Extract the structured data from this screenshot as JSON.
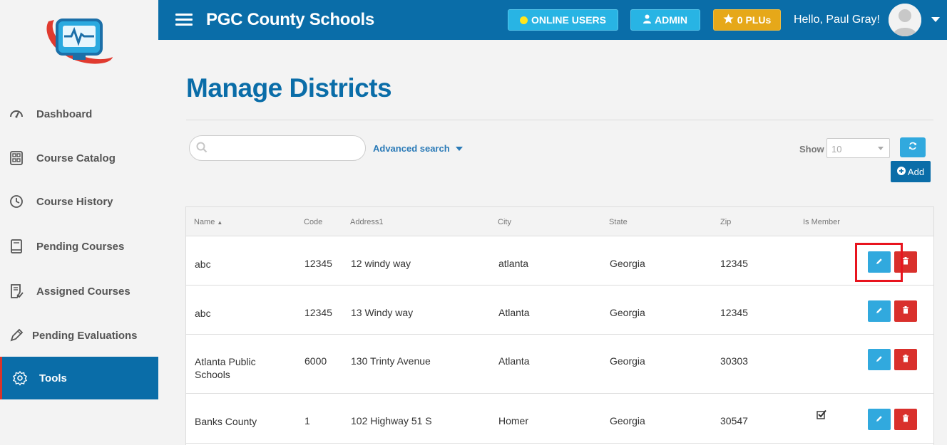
{
  "header": {
    "app_title": "PGC County Schools",
    "online_users": "ONLINE USERS",
    "admin": "ADMIN",
    "plus": "0 PLUs",
    "hello": "Hello,",
    "user_name": "Paul Gray!"
  },
  "sidebar": {
    "items": [
      {
        "label": "Dashboard",
        "icon": "gauge-icon"
      },
      {
        "label": "Course Catalog",
        "icon": "catalog-icon"
      },
      {
        "label": "Course History",
        "icon": "history-icon"
      },
      {
        "label": "Pending Courses",
        "icon": "book-icon"
      },
      {
        "label": "Assigned Courses",
        "icon": "assigned-icon"
      },
      {
        "label": "Pending Evaluations",
        "icon": "pencil-icon"
      },
      {
        "label": "Tools",
        "icon": "gear-icon",
        "active": true
      }
    ]
  },
  "main": {
    "page_title": "Manage Districts",
    "search_placeholder": "",
    "advanced_search": "Advanced search",
    "show_label": "Show",
    "show_value": "10",
    "add_label": "Add"
  },
  "table": {
    "columns": [
      "Name",
      "Code",
      "Address1",
      "City",
      "State",
      "Zip",
      "Is Member"
    ],
    "rows": [
      {
        "name": "abc",
        "code": "12345",
        "address": "12 windy way",
        "city": "atlanta",
        "state": "Georgia",
        "zip": "12345",
        "member": false
      },
      {
        "name": "abc",
        "code": "12345",
        "address": "13 Windy way",
        "city": "Atlanta",
        "state": "Georgia",
        "zip": "12345",
        "member": false
      },
      {
        "name": "Atlanta Public Schools",
        "code": "6000",
        "address": "130 Trinty Avenue",
        "city": "Atlanta",
        "state": "Georgia",
        "zip": "30303",
        "member": false
      },
      {
        "name": "Banks County",
        "code": "1",
        "address": "102 Highway 51 S",
        "city": "Homer",
        "state": "Georgia",
        "zip": "30547",
        "member": true
      }
    ]
  },
  "colors": {
    "primary": "#0a6da8",
    "info": "#31a9de",
    "danger": "#d9302c",
    "warning": "#e6a819",
    "highlight": "#e8141e"
  }
}
